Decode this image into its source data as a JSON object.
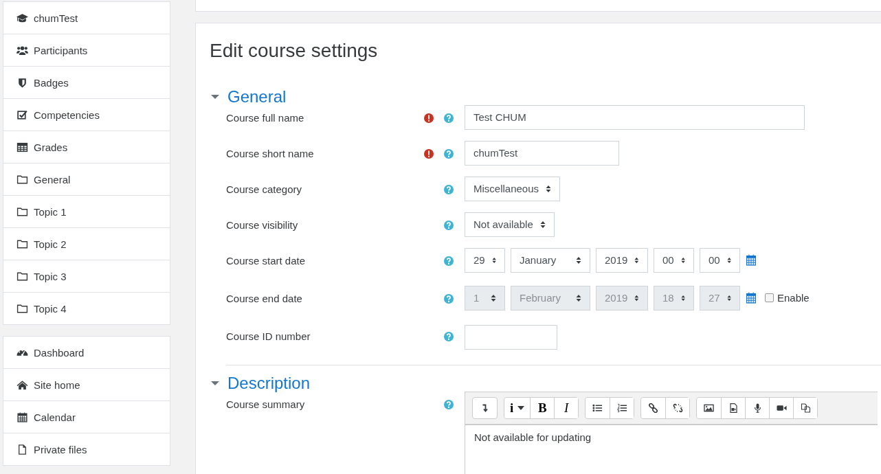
{
  "sidebar": {
    "groups": [
      {
        "items": [
          {
            "label": "chumTest"
          },
          {
            "label": "Participants"
          },
          {
            "label": "Badges"
          },
          {
            "label": "Competencies"
          },
          {
            "label": "Grades"
          },
          {
            "label": "General"
          },
          {
            "label": "Topic 1"
          },
          {
            "label": "Topic 2"
          },
          {
            "label": "Topic 3"
          },
          {
            "label": "Topic 4"
          }
        ]
      },
      {
        "items": [
          {
            "label": "Dashboard"
          },
          {
            "label": "Site home"
          },
          {
            "label": "Calendar"
          },
          {
            "label": "Private files"
          }
        ]
      }
    ]
  },
  "page": {
    "title": "Edit course settings",
    "sections": [
      {
        "title": "General",
        "expanded": true,
        "fields": [
          {
            "kind": "text",
            "label": "Course full name",
            "required": true,
            "value": "Test CHUM"
          },
          {
            "kind": "text",
            "label": "Course short name",
            "required": true,
            "value": "chumTest"
          },
          {
            "kind": "select",
            "label": "Course category",
            "required": false,
            "value": "Miscellaneous"
          },
          {
            "kind": "select",
            "label": "Course visibility",
            "required": false,
            "value": "Not available"
          },
          {
            "kind": "date",
            "label": "Course start date",
            "required": false,
            "disabled": false,
            "parts": [
              "29",
              "January",
              "2019",
              "00",
              "00"
            ]
          },
          {
            "kind": "date",
            "label": "Course end date",
            "required": false,
            "disabled": true,
            "parts": [
              "1",
              "February",
              "2019",
              "18",
              "27"
            ],
            "enable": {
              "label": "Enable",
              "checked": false
            }
          },
          {
            "kind": "text",
            "label": "Course ID number",
            "required": false
          }
        ]
      },
      {
        "title": "Description",
        "expanded": true,
        "fields": [
          {
            "kind": "editor",
            "label": "Course summary",
            "required": false,
            "content": "Not available for updating",
            "toolbar": [
              {
                "text": "i"
              },
              {
                "text": "B"
              },
              {
                "text": "I"
              }
            ]
          }
        ]
      }
    ]
  }
}
